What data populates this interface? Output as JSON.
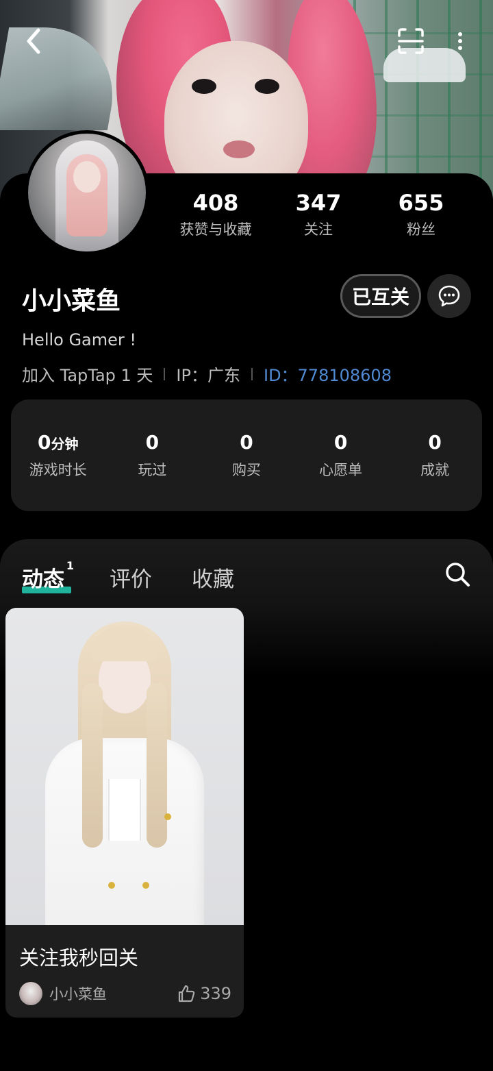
{
  "header": {
    "back_icon": "chevron-left-icon",
    "scan_icon": "scan-icon",
    "more_icon": "more-vertical-icon"
  },
  "profile": {
    "username": "小小菜鱼",
    "bio": "Hello Gamer !",
    "joined": "加入 TapTap 1 天",
    "ip": "IP：广东",
    "user_id": "ID：778108608",
    "mutual_follow_label": "已互关",
    "message_icon": "message-icon",
    "stats": [
      {
        "value": "408",
        "label": "获赞与收藏"
      },
      {
        "value": "347",
        "label": "关注"
      },
      {
        "value": "655",
        "label": "粉丝"
      }
    ]
  },
  "game_stats": {
    "playtime": {
      "value": "0",
      "unit": "分钟",
      "label": "游戏时长"
    },
    "items": [
      {
        "value": "0",
        "label": "玩过"
      },
      {
        "value": "0",
        "label": "购买"
      },
      {
        "value": "0",
        "label": "心愿单"
      },
      {
        "value": "0",
        "label": "成就"
      }
    ]
  },
  "tabs": {
    "items": [
      {
        "label": "动态",
        "badge": "1"
      },
      {
        "label": "评价"
      },
      {
        "label": "收藏"
      }
    ],
    "active_color": "#1fb39b",
    "search_icon": "search-icon"
  },
  "posts": [
    {
      "title": "关注我秒回关",
      "author": "小小菜鱼",
      "likes": "339"
    }
  ],
  "colors": {
    "accent_id": "#4f8ad3",
    "tab_underline": "#1fb39b",
    "background": "#000000"
  }
}
